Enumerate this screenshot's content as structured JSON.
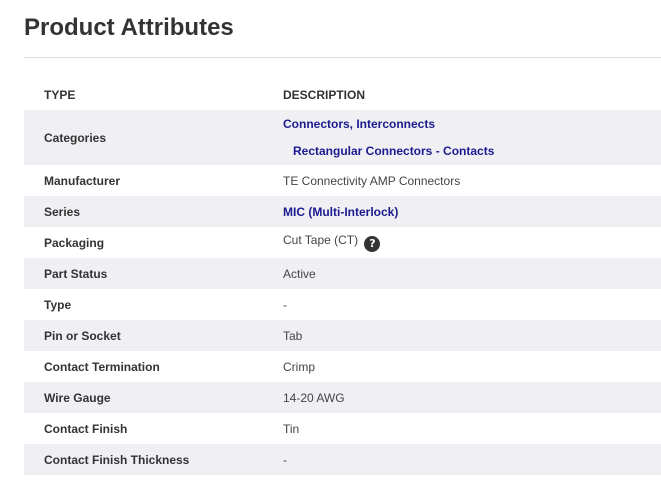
{
  "title": "Product Attributes",
  "table": {
    "headers": {
      "type": "TYPE",
      "description": "DESCRIPTION"
    },
    "rows": [
      {
        "type": "Categories",
        "links": [
          "Connectors, Interconnects",
          "Rectangular Connectors - Contacts"
        ]
      },
      {
        "type": "Manufacturer",
        "value": "TE Connectivity AMP Connectors"
      },
      {
        "type": "Series",
        "link": "MIC (Multi-Interlock)"
      },
      {
        "type": "Packaging",
        "value": "Cut Tape (CT)",
        "help_icon": "?"
      },
      {
        "type": "Part Status",
        "value": "Active"
      },
      {
        "type": "Type",
        "value": "-"
      },
      {
        "type": "Pin or Socket",
        "value": "Tab"
      },
      {
        "type": "Contact Termination",
        "value": "Crimp"
      },
      {
        "type": "Wire Gauge",
        "value": "14-20 AWG"
      },
      {
        "type": "Contact Finish",
        "value": "Tin"
      },
      {
        "type": "Contact Finish Thickness",
        "value": "-"
      }
    ]
  },
  "colors": {
    "link": "#1b1b8f",
    "row_shaded": "#f0f0f4",
    "divider": "#dcdcdc"
  },
  "icons": {
    "help": "question-circle-icon"
  }
}
